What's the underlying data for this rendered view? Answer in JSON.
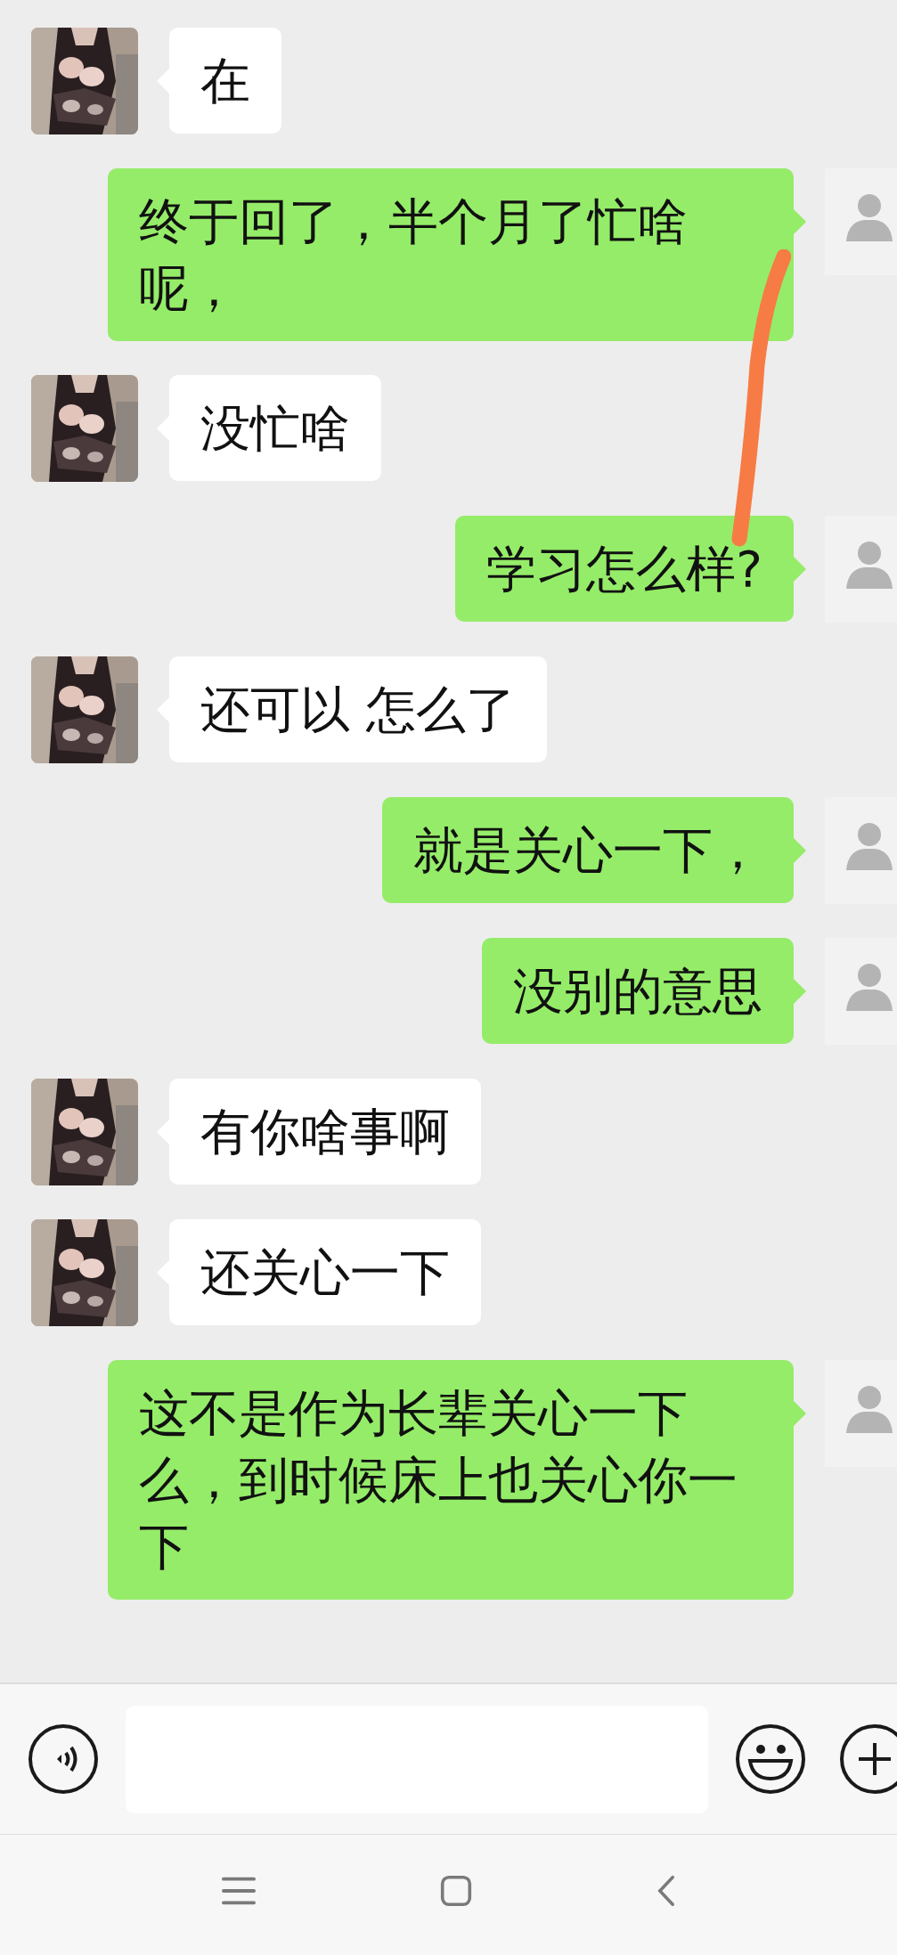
{
  "messages": [
    {
      "kind": "received",
      "text": "在"
    },
    {
      "kind": "sent",
      "text": "终于回了，半个月了忙啥呢，"
    },
    {
      "kind": "received",
      "text": "没忙啥"
    },
    {
      "kind": "sent",
      "text": "学习怎么样?"
    },
    {
      "kind": "received",
      "text": "还可以 怎么了"
    },
    {
      "kind": "sent",
      "text": "就是关心一下，"
    },
    {
      "kind": "sent",
      "text": "没别的意思"
    },
    {
      "kind": "received",
      "text": "有你啥事啊"
    },
    {
      "kind": "received",
      "text": "还关心一下"
    },
    {
      "kind": "sent",
      "text": "这不是作为长辈关心一下么，到时候床上也关心你一下"
    }
  ]
}
